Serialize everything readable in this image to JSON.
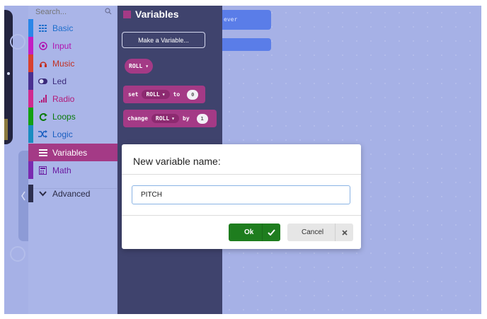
{
  "search": {
    "placeholder": "Search..."
  },
  "toolbox": {
    "categories": [
      {
        "label": "Basic",
        "color": "#1e90ff",
        "icon": "grid-icon"
      },
      {
        "label": "Input",
        "color": "#d400d4",
        "icon": "radio-target-icon"
      },
      {
        "label": "Music",
        "color": "#e63022",
        "icon": "headphones-icon"
      },
      {
        "label": "Led",
        "color": "#5c2d91",
        "icon": "toggle-icon"
      },
      {
        "label": "Radio",
        "color": "#e3008c",
        "icon": "signal-bars-icon"
      },
      {
        "label": "Loops",
        "color": "#00aa00",
        "icon": "loop-arrow-icon"
      },
      {
        "label": "Logic",
        "color": "#00a4a6",
        "icon": "shuffle-icon"
      },
      {
        "label": "Variables",
        "color": "#dc143c",
        "icon": "list-icon"
      },
      {
        "label": "Math",
        "color": "#9400d3",
        "icon": "calculator-icon"
      }
    ],
    "advanced": {
      "label": "Advanced",
      "color": "#3c3c3c"
    }
  },
  "flyout": {
    "title": "Variables",
    "make_variable_label": "Make a Variable...",
    "var_pill": "ROLL",
    "set_block": {
      "kw1": "set",
      "var": "ROLL",
      "kw2": "to",
      "value": "0"
    },
    "change_block": {
      "kw1": "change",
      "var": "ROLL",
      "kw2": "by",
      "value": "1"
    }
  },
  "workspace": {
    "block_text": "ever"
  },
  "modal": {
    "title": "New variable name:",
    "input_value": "PITCH",
    "ok_label": "Ok",
    "cancel_label": "Cancel"
  },
  "colors": {
    "variables": "#a43a86",
    "ok_green": "#1e7d1e",
    "flyout_bg": "#3f436d"
  }
}
